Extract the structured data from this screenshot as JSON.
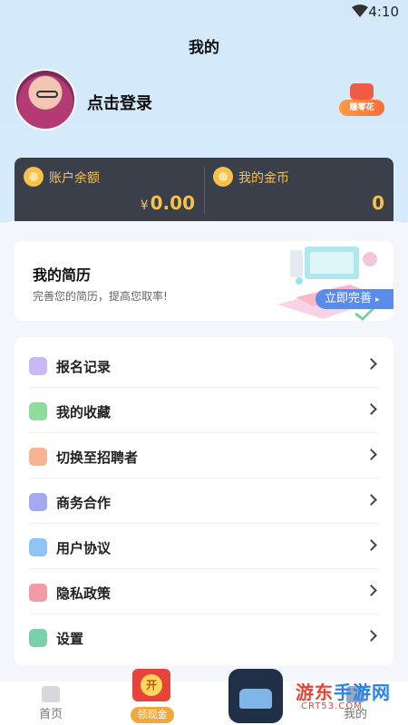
{
  "status_bar": {
    "time": "4:10"
  },
  "header": {
    "title": "我的"
  },
  "profile": {
    "login_prompt": "点击登录",
    "reward_badge": "赚零花"
  },
  "balances": {
    "account": {
      "label": "账户余额",
      "currency": "¥",
      "value": "0.00"
    },
    "coins": {
      "label": "我的金币",
      "value": "0"
    }
  },
  "resume": {
    "title": "我的简历",
    "subtitle": "完善您的简历，提高您取率!",
    "button": "立即完善"
  },
  "menu": [
    {
      "label": "报名记录",
      "icon": "signup-record-icon",
      "color": "#c9b8f2"
    },
    {
      "label": "我的收藏",
      "icon": "heart-icon",
      "color": "#8fdc9a"
    },
    {
      "label": "切换至招聘者",
      "icon": "switch-recruiter-icon",
      "color": "#f7b493"
    },
    {
      "label": "商务合作",
      "icon": "handshake-icon",
      "color": "#a3a8f0"
    },
    {
      "label": "用户协议",
      "icon": "document-icon",
      "color": "#8ec3f5"
    },
    {
      "label": "隐私政策",
      "icon": "privacy-icon",
      "color": "#f49aa5"
    },
    {
      "label": "设置",
      "icon": "gear-icon",
      "color": "#7ad0a8"
    }
  ],
  "tabbar": {
    "home": "首页",
    "cash_button": {
      "coin": "开",
      "label": "领现金"
    },
    "mine": "我的"
  },
  "watermark": {
    "text_a": "游东",
    "text_b": "手游网",
    "domain": "CRT53.COM"
  }
}
